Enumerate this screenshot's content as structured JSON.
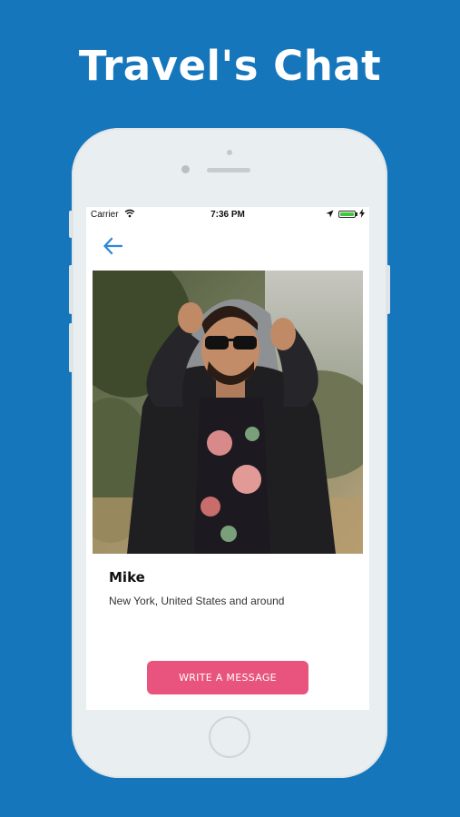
{
  "promo": {
    "headline": "Travel's Chat",
    "background_color": "#1576bb"
  },
  "status_bar": {
    "carrier": "Carrier",
    "time": "7:36 PM",
    "battery_level": 1.0,
    "charging": true
  },
  "nav": {
    "back_icon": "arrow-left-icon",
    "accent_color": "#2d88d6"
  },
  "profile": {
    "photo_description_icon": "profile-photo",
    "name": "Mike",
    "location": "New York, United States and around"
  },
  "actions": {
    "write_message_label": "WRITE A MESSAGE",
    "button_color": "#e8547e"
  }
}
